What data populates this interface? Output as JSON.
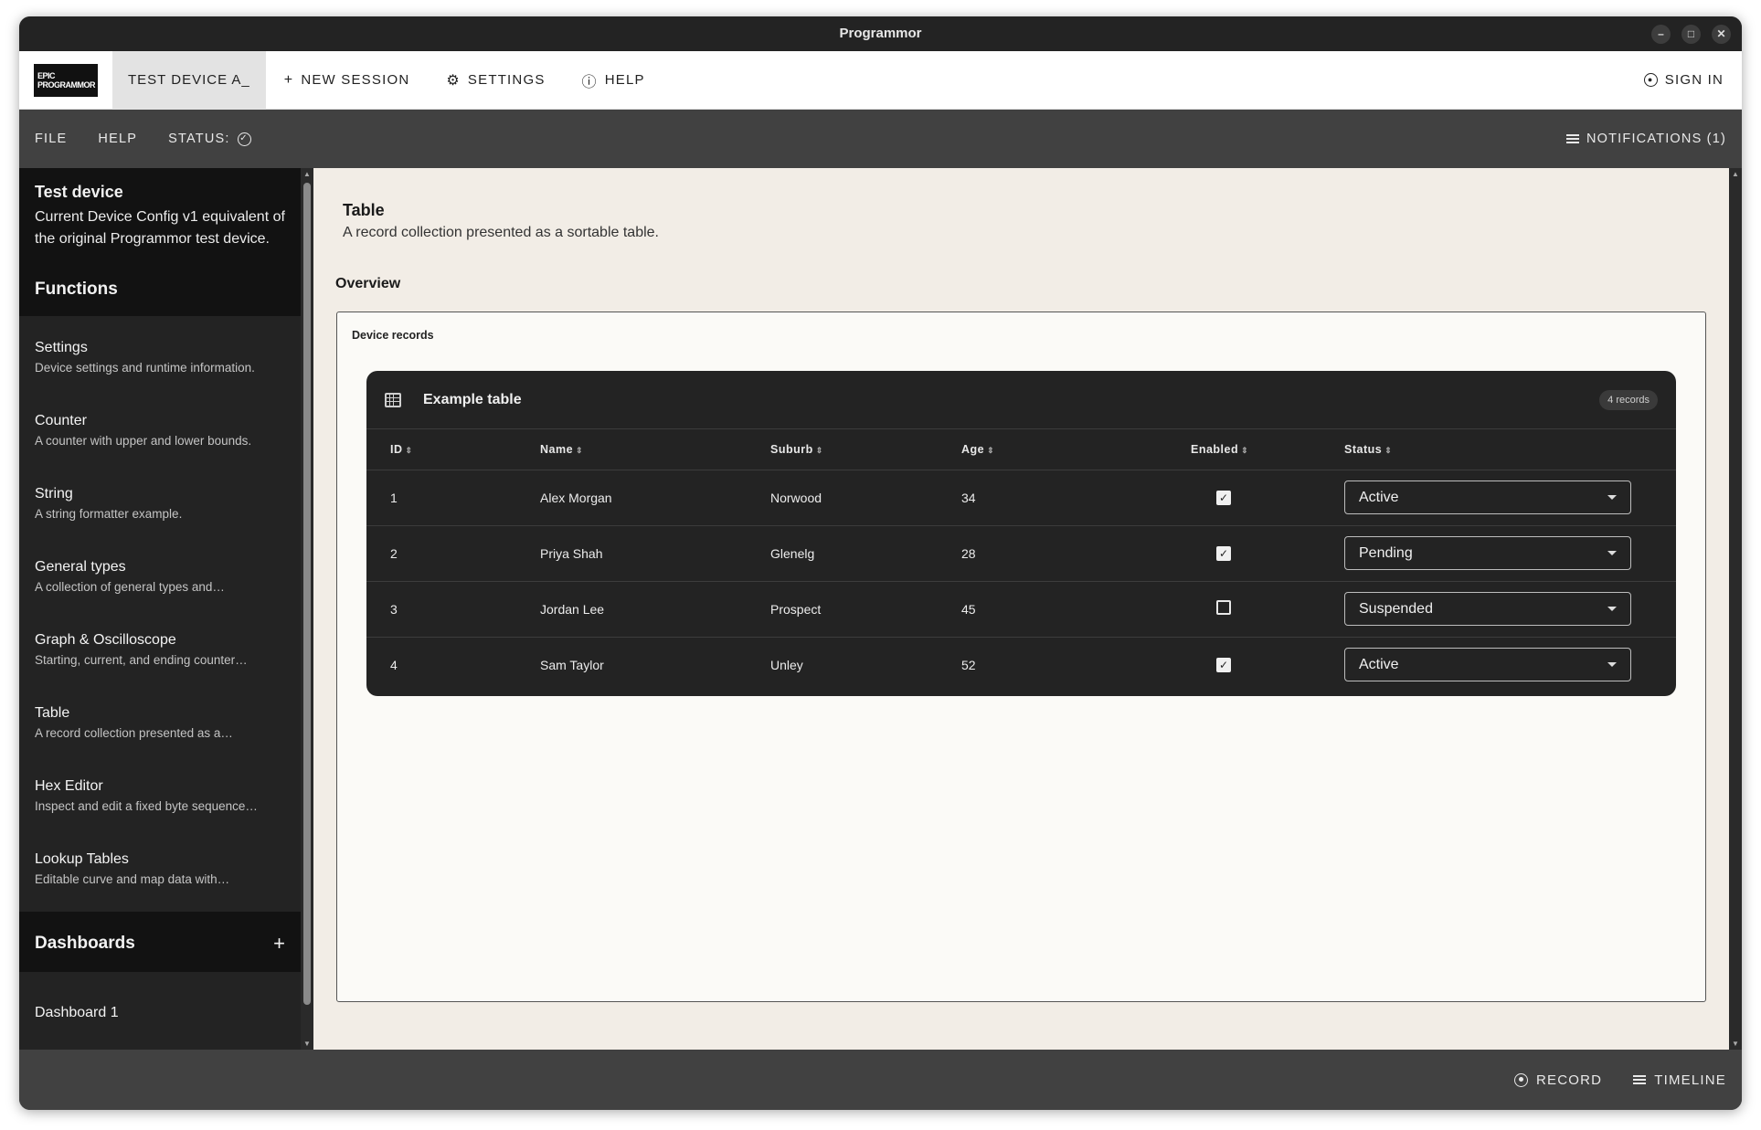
{
  "window": {
    "title": "Programmor"
  },
  "appbar": {
    "logo_text": "EPIC PROGRAMMOR",
    "active_tab": "TEST DEVICE A_",
    "new_session": "NEW SESSION",
    "settings": "SETTINGS",
    "help": "HELP",
    "sign_in": "SIGN IN"
  },
  "menubar": {
    "file": "FILE",
    "help": "HELP",
    "status": "STATUS:",
    "notifications": "NOTIFICATIONS (1)"
  },
  "sidebar": {
    "device_title": "Test device",
    "device_desc": "Current Device Config v1 equivalent of the original Programmor test device.",
    "functions_heading": "Functions",
    "items": [
      {
        "title": "Settings",
        "desc": "Device settings and runtime information."
      },
      {
        "title": "Counter",
        "desc": "A counter with upper and lower bounds."
      },
      {
        "title": "String",
        "desc": "A string formatter example."
      },
      {
        "title": "General types",
        "desc": "A collection of general types and…"
      },
      {
        "title": "Graph & Oscilloscope",
        "desc": "Starting, current, and ending counter…"
      },
      {
        "title": "Table",
        "desc": "A record collection presented as a…"
      },
      {
        "title": "Hex Editor",
        "desc": "Inspect and edit a fixed byte sequence…"
      },
      {
        "title": "Lookup Tables",
        "desc": "Editable curve and map data with…"
      }
    ],
    "dashboards_heading": "Dashboards",
    "dashboards_add": "+",
    "dashboard_items": [
      "Dashboard 1"
    ]
  },
  "main": {
    "title": "Table",
    "subtitle": "A record collection presented as a sortable table.",
    "overview": "Overview",
    "panel_title": "Device records",
    "table": {
      "title": "Example table",
      "record_badge": "4 records",
      "columns": [
        "ID",
        "Name",
        "Suburb",
        "Age",
        "Enabled",
        "Status"
      ],
      "rows": [
        {
          "id": "1",
          "name": "Alex Morgan",
          "suburb": "Norwood",
          "age": "34",
          "enabled": true,
          "status": "Active"
        },
        {
          "id": "2",
          "name": "Priya Shah",
          "suburb": "Glenelg",
          "age": "28",
          "enabled": true,
          "status": "Pending"
        },
        {
          "id": "3",
          "name": "Jordan Lee",
          "suburb": "Prospect",
          "age": "45",
          "enabled": false,
          "status": "Suspended"
        },
        {
          "id": "4",
          "name": "Sam Taylor",
          "suburb": "Unley",
          "age": "52",
          "enabled": true,
          "status": "Active"
        }
      ]
    }
  },
  "footer": {
    "record": "RECORD",
    "timeline": "TIMELINE"
  },
  "icons": {
    "minimize": "minimize-icon",
    "maximize": "maximize-icon",
    "close": "close-icon",
    "plus": "plus-icon",
    "gear": "gear-icon",
    "help": "help-circle-icon",
    "user": "user-circle-icon",
    "status_ok": "check-circle-icon",
    "notifications": "menu-lines-icon",
    "table": "table-grid-icon",
    "record": "record-icon",
    "timeline": "menu-lines-icon"
  },
  "colors": {
    "titlebar": "#232323",
    "menubar": "#414141",
    "sidebar": "#232323",
    "main_bg": "#f2ede6",
    "card": "#232323"
  }
}
